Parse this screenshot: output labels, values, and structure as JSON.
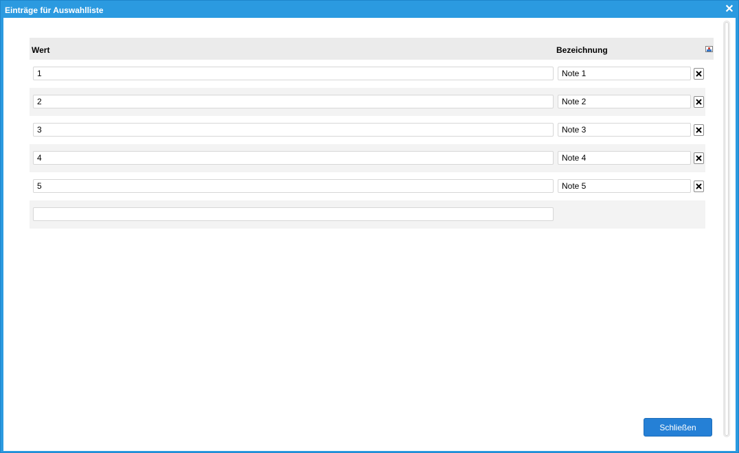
{
  "dialog": {
    "title": "Einträge für Auswahlliste",
    "close_icon": "close-icon"
  },
  "table": {
    "headers": {
      "wert": "Wert",
      "bezeichnung": "Bezeichnung"
    },
    "header_icon": "sort-icon",
    "rows": [
      {
        "wert": "1",
        "bezeichnung": "Note 1"
      },
      {
        "wert": "2",
        "bezeichnung": "Note 2"
      },
      {
        "wert": "3",
        "bezeichnung": "Note 3"
      },
      {
        "wert": "4",
        "bezeichnung": "Note 4"
      },
      {
        "wert": "5",
        "bezeichnung": "Note 5"
      }
    ],
    "new_row": {
      "wert": ""
    }
  },
  "footer": {
    "close_button_label": "Schließen"
  },
  "colors": {
    "accent": "#2b9ae0",
    "button": "#2580d6"
  }
}
